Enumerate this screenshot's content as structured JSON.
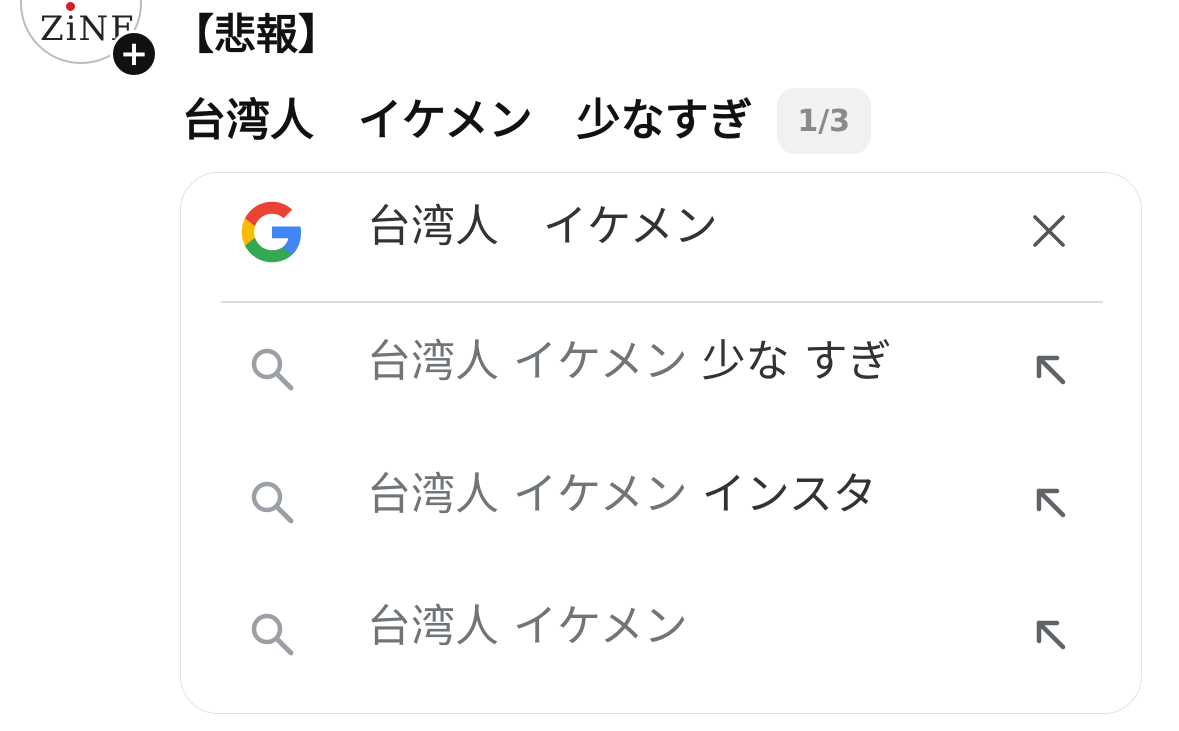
{
  "avatar": {
    "text": "ZiNE"
  },
  "follow_button": {
    "label": "+"
  },
  "post": {
    "tag": "【悲報】",
    "title": "台湾人　イケメン　少なすぎ",
    "page_indicator": "1/3"
  },
  "search": {
    "query": "台湾人　イケメン",
    "brand_icon": "google-g-icon",
    "clear_icon": "close-icon",
    "colors": {
      "google_blue": "#4285F4",
      "google_red": "#EA4335",
      "google_yellow": "#FBBC05",
      "google_green": "#34A853",
      "typed_text": "#70757a",
      "completion_text": "#333333"
    },
    "suggestions": [
      {
        "typed": "台湾人 イケメン",
        "completion": " 少な すぎ",
        "icon": "search-icon",
        "action_icon": "arrow-up-left-icon"
      },
      {
        "typed": "台湾人 イケメン",
        "completion": " インスタ",
        "icon": "search-icon",
        "action_icon": "arrow-up-left-icon"
      },
      {
        "typed": "台湾人 イケメン",
        "completion": "",
        "icon": "search-icon",
        "action_icon": "arrow-up-left-icon"
      }
    ]
  }
}
